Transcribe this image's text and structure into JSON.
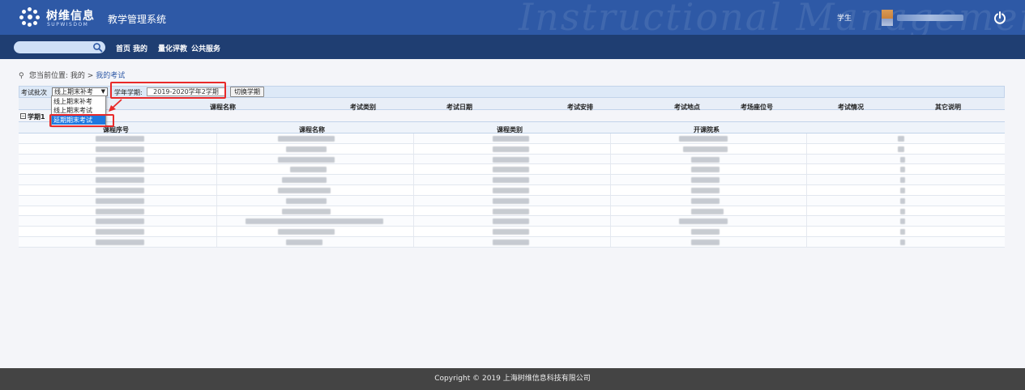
{
  "header": {
    "brand_cn": "树维信息",
    "brand_en": "SUPWISDOM",
    "system_name": "教学管理系统",
    "background_script": "Instructional Management",
    "user_role": "学生",
    "power_icon": "power-icon"
  },
  "nav": {
    "search_placeholder": "",
    "items": [
      "首页",
      "我的",
      "量化评教",
      "公共服务"
    ]
  },
  "breadcrumb": {
    "prefix": "您当前位置: ",
    "parent": "我的",
    "separator": " > ",
    "current": "我的考试"
  },
  "filters": {
    "batch_label": "考试批次",
    "batch_value": "线上期末补考",
    "batch_options": [
      "线上期末补考",
      "线上期末考试",
      "延期期末考试"
    ],
    "batch_highlighted": "延期期末考试",
    "term_label": "学年学期:",
    "term_value": "2019-2020学年2学期",
    "switch_button": "切换学期"
  },
  "exam_table": {
    "headers": [
      "课程名称",
      "考试类别",
      "考试日期",
      "考试安排",
      "考试地点",
      "考场座位号",
      "考试情况",
      "其它说明"
    ]
  },
  "term_row": {
    "expand_symbol": "−",
    "label": "学期1"
  },
  "course_table": {
    "headers": [
      "课程序号",
      "课程名称",
      "课程类别",
      "开课院系"
    ],
    "row_count": 11
  },
  "footer": {
    "text": "Copyright © 2019 上海树维信息科技有限公司"
  },
  "colors": {
    "header_bg": "#2e59a6",
    "nav_bg": "#1f3e72",
    "annotation_red": "#e82a2a",
    "selected_option": "#1e78e0",
    "footer_bg": "#444444"
  }
}
